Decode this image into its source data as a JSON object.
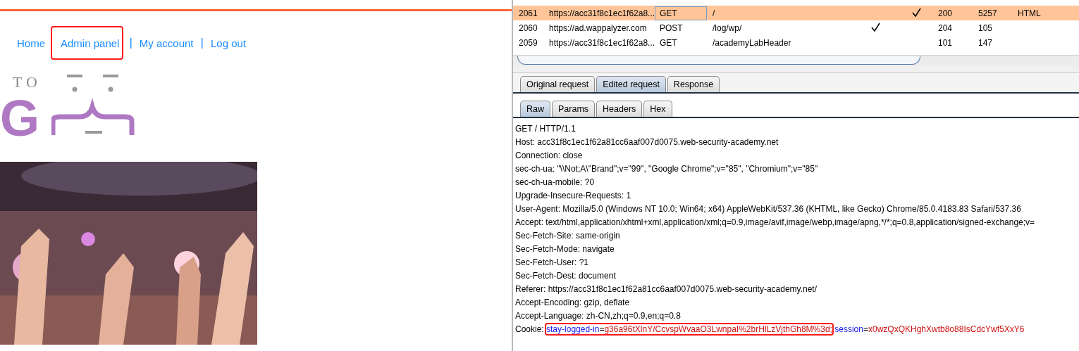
{
  "site": {
    "nav": [
      {
        "kind": "link",
        "label": "Home",
        "highlighted": false
      },
      {
        "kind": "link",
        "label": "Admin panel",
        "highlighted": true
      },
      {
        "kind": "separator",
        "label": "|"
      },
      {
        "kind": "link",
        "label": "My account",
        "highlighted": false
      },
      {
        "kind": "separator",
        "label": "|"
      },
      {
        "kind": "link",
        "label": "Log out",
        "highlighted": false
      }
    ],
    "logo": {
      "small_text": "TO",
      "big_letter": "G"
    }
  },
  "history": {
    "rows": [
      {
        "number": "2061",
        "url": "https://acc31f8c1ec1f62a8...",
        "method": "GET",
        "path": "/",
        "column_5_checked": false,
        "column_6_checked": true,
        "status": "200",
        "length": "5257",
        "mime": "HTML",
        "selected": true
      },
      {
        "number": "2060",
        "url": "https://ad.wappalyzer.com",
        "method": "POST",
        "path": "/log/wp/",
        "column_5_checked": true,
        "column_6_checked": false,
        "status": "204",
        "length": "105",
        "mime": "",
        "selected": false
      },
      {
        "number": "2059",
        "url": "https://acc31f8c1ec1f62a8...",
        "method": "GET",
        "path": "/academyLabHeader",
        "column_5_checked": false,
        "column_6_checked": false,
        "status": "101",
        "length": "147",
        "mime": "",
        "selected": false
      }
    ]
  },
  "tabs": [
    {
      "label": "Original request",
      "selected": false
    },
    {
      "label": "Edited request",
      "selected": true
    },
    {
      "label": "Response",
      "selected": false
    }
  ],
  "subtabs": [
    {
      "label": "Raw",
      "selected": true
    },
    {
      "label": "Params",
      "selected": false
    },
    {
      "label": "Headers",
      "selected": false
    },
    {
      "label": "Hex",
      "selected": false
    }
  ],
  "request": {
    "lines": [
      "GET / HTTP/1.1",
      "Host: acc31f8c1ec1f62a81cc6aaf007d0075.web-security-academy.net",
      "Connection: close",
      "sec-ch-ua: \"\\\\Not;A\\\"Brand\";v=\"99\", \"Google Chrome\";v=\"85\", \"Chromium\";v=\"85\"",
      "sec-ch-ua-mobile: ?0",
      "Upgrade-Insecure-Requests: 1",
      "User-Agent: Mozilla/5.0 (Windows NT 10.0; Win64; x64) AppleWebKit/537.36 (KHTML, like Gecko) Chrome/85.0.4183.83 Safari/537.36",
      "Accept: text/html,application/xhtml+xml,application/xml;q=0.9,image/avif,image/webp,image/apng,*/*;q=0.8,application/signed-exchange;v=",
      "Sec-Fetch-Site: same-origin",
      "Sec-Fetch-Mode: navigate",
      "Sec-Fetch-User: ?1",
      "Sec-Fetch-Dest: document",
      "Referer: https://acc31f8c1ec1f62a81cc6aaf007d0075.web-security-academy.net/",
      "Accept-Encoding: gzip, deflate",
      "Accept-Language: zh-CN,zh;q=0.9,en;q=0.8"
    ],
    "cookie": {
      "label": "Cookie:",
      "items": [
        {
          "name": "stay-logged-in",
          "equals": "=",
          "value": "g36a96tXlnY/CcvspWvaaO3LwnpaI%2brHlLzVjthGh8M%3d;",
          "highlighted": true
        },
        {
          "name": "session",
          "equals": "=",
          "value": "x0wzQxQKHghXwtb8o88IsCdcYwf5XxY6",
          "highlighted": false
        }
      ]
    }
  }
}
